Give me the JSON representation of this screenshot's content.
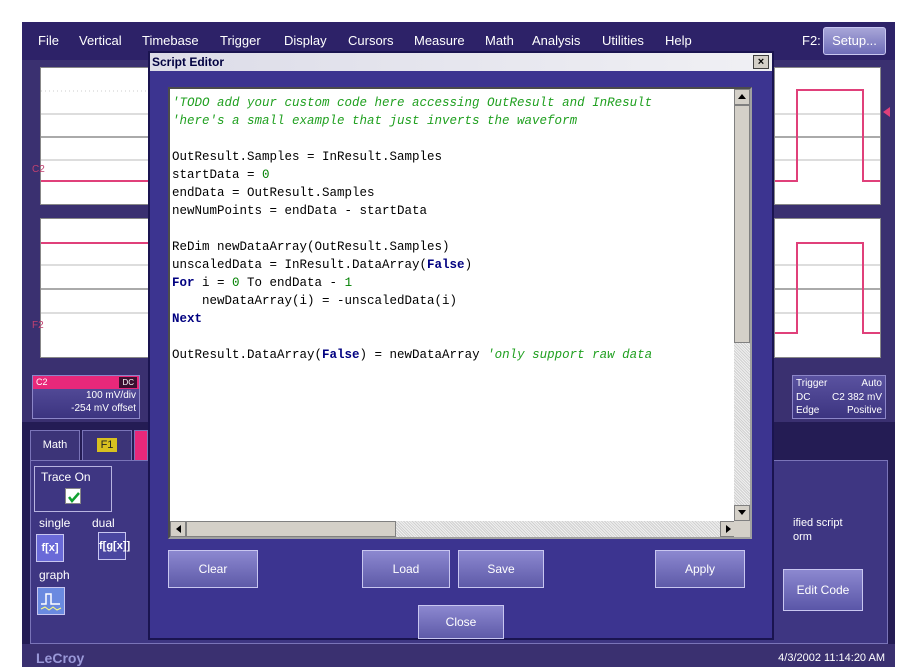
{
  "menubar": {
    "items": [
      "File",
      "Vertical",
      "Timebase",
      "Trigger",
      "Display",
      "Cursors",
      "Measure",
      "Math",
      "Analysis",
      "Utilities",
      "Help"
    ],
    "f2_label": "F2:",
    "setup_label": "Setup..."
  },
  "channels": {
    "c2_label": "C2",
    "f2_label": "F2"
  },
  "c2_descriptor": {
    "name": "C2",
    "badge": "DC",
    "volts_div": "100 mV/div",
    "offset": "-254 mV offset"
  },
  "trigger_descriptor": {
    "title": "Trigger",
    "mode": "Auto",
    "coupling": "DC",
    "level": "C2 382 mV",
    "type": "Edge",
    "slope": "Positive"
  },
  "bottom_panel": {
    "tab_math": "Math",
    "tab_f1": "F1",
    "trace_on_label": "Trace On",
    "single_label": "single",
    "dual_label": "dual",
    "single_func": "f[x]",
    "dual_func": "f[g[x]]",
    "graph_label": "graph",
    "script_note_1": "ified script",
    "script_note_2": "orm",
    "edit_code_label": "Edit Code"
  },
  "status": {
    "logo": "LeCroy",
    "timestamp": "4/3/2002 11:14:20 AM"
  },
  "script_editor": {
    "title": "Script Editor",
    "close_x": "×",
    "code_lines": [
      [
        {
          "t": "'TODO add your custom code here accessing OutResult and InResult",
          "c": "comment"
        }
      ],
      [
        {
          "t": "'here's a small example that just inverts the waveform",
          "c": "comment"
        }
      ],
      [],
      [
        {
          "t": "OutResult.Samples = InResult.Samples",
          "c": "plain"
        }
      ],
      [
        {
          "t": "startData = ",
          "c": "plain"
        },
        {
          "t": "0",
          "c": "number"
        }
      ],
      [
        {
          "t": "endData = OutResult.Samples",
          "c": "plain"
        }
      ],
      [
        {
          "t": "newNumPoints = endData - startData",
          "c": "plain"
        }
      ],
      [],
      [
        {
          "t": "ReDim newDataArray(OutResult.Samples)",
          "c": "plain"
        }
      ],
      [
        {
          "t": "unscaledData = InResult.DataArray(",
          "c": "plain"
        },
        {
          "t": "False",
          "c": "keyword"
        },
        {
          "t": ")",
          "c": "plain"
        }
      ],
      [
        {
          "t": "For",
          "c": "keyword"
        },
        {
          "t": " i = ",
          "c": "plain"
        },
        {
          "t": "0",
          "c": "number"
        },
        {
          "t": " To endData - ",
          "c": "plain"
        },
        {
          "t": "1",
          "c": "number"
        }
      ],
      [
        {
          "t": "    newDataArray(i) = -unscaledData(i)",
          "c": "plain"
        }
      ],
      [
        {
          "t": "Next",
          "c": "keyword"
        }
      ],
      [],
      [
        {
          "t": "OutResult.DataArray(",
          "c": "plain"
        },
        {
          "t": "False",
          "c": "keyword"
        },
        {
          "t": ") = newDataArray ",
          "c": "plain"
        },
        {
          "t": "'only support raw data",
          "c": "comment"
        }
      ]
    ],
    "buttons": {
      "clear": "Clear",
      "load": "Load",
      "save": "Save",
      "apply": "Apply",
      "close": "Close"
    }
  },
  "colors": {
    "trace": "#e0407a",
    "frame": "#3a3070",
    "comment": "#20a020",
    "keyword": "#000080"
  }
}
